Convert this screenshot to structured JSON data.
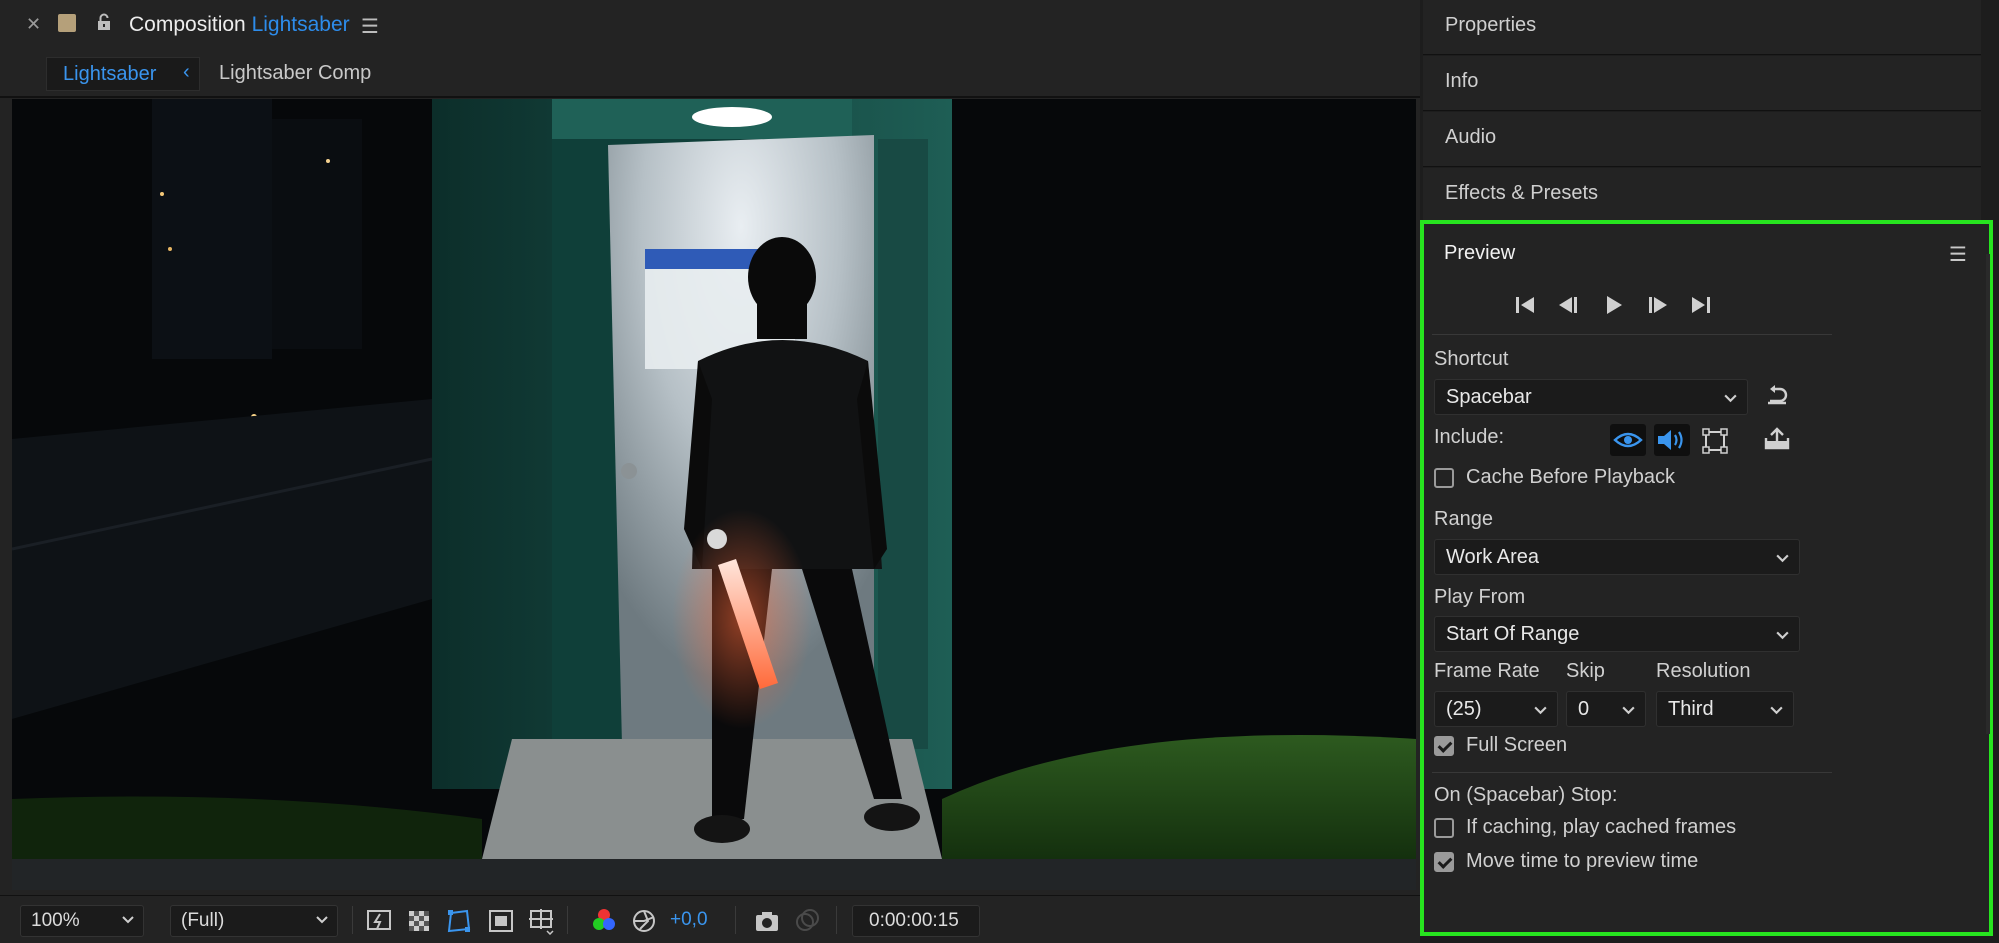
{
  "composition": {
    "prefix": "Composition",
    "name": "Lightsaber",
    "tabs": [
      {
        "label": "Lightsaber",
        "active": true
      },
      {
        "label": "Lightsaber Comp",
        "active": false
      }
    ],
    "footer": {
      "zoom": "100%",
      "resolution": "(Full)",
      "exposure": "+0,0",
      "timecode": "0:00:00:15"
    }
  },
  "right_panels": {
    "collapsed": [
      "Properties",
      "Info",
      "Audio",
      "Effects & Presets"
    ]
  },
  "preview": {
    "title": "Preview",
    "shortcut_label": "Shortcut",
    "shortcut_value": "Spacebar",
    "include_label": "Include:",
    "cache_before_playback": {
      "label": "Cache Before Playback",
      "checked": false
    },
    "range_label": "Range",
    "range_value": "Work Area",
    "play_from_label": "Play From",
    "play_from_value": "Start Of Range",
    "frame_rate_label": "Frame Rate",
    "frame_rate_value": "(25)",
    "skip_label": "Skip",
    "skip_value": "0",
    "resolution_label": "Resolution",
    "resolution_value": "Third",
    "full_screen": {
      "label": "Full Screen",
      "checked": true
    },
    "on_stop_label": "On (Spacebar) Stop:",
    "if_caching": {
      "label": "If caching, play cached frames",
      "checked": false
    },
    "move_time": {
      "label": "Move time to preview time",
      "checked": true
    }
  },
  "colors": {
    "accent": "#2d8ceb",
    "highlight_border": "#27e41f",
    "panel_bg": "#232323"
  },
  "icons": [
    "close-icon",
    "lock-icon",
    "hamburger-icon",
    "first-frame-icon",
    "previous-frame-icon",
    "play-icon",
    "next-frame-icon",
    "last-frame-icon",
    "reset-icon",
    "eye-icon",
    "speaker-icon",
    "overlay-icon",
    "export-icon"
  ]
}
